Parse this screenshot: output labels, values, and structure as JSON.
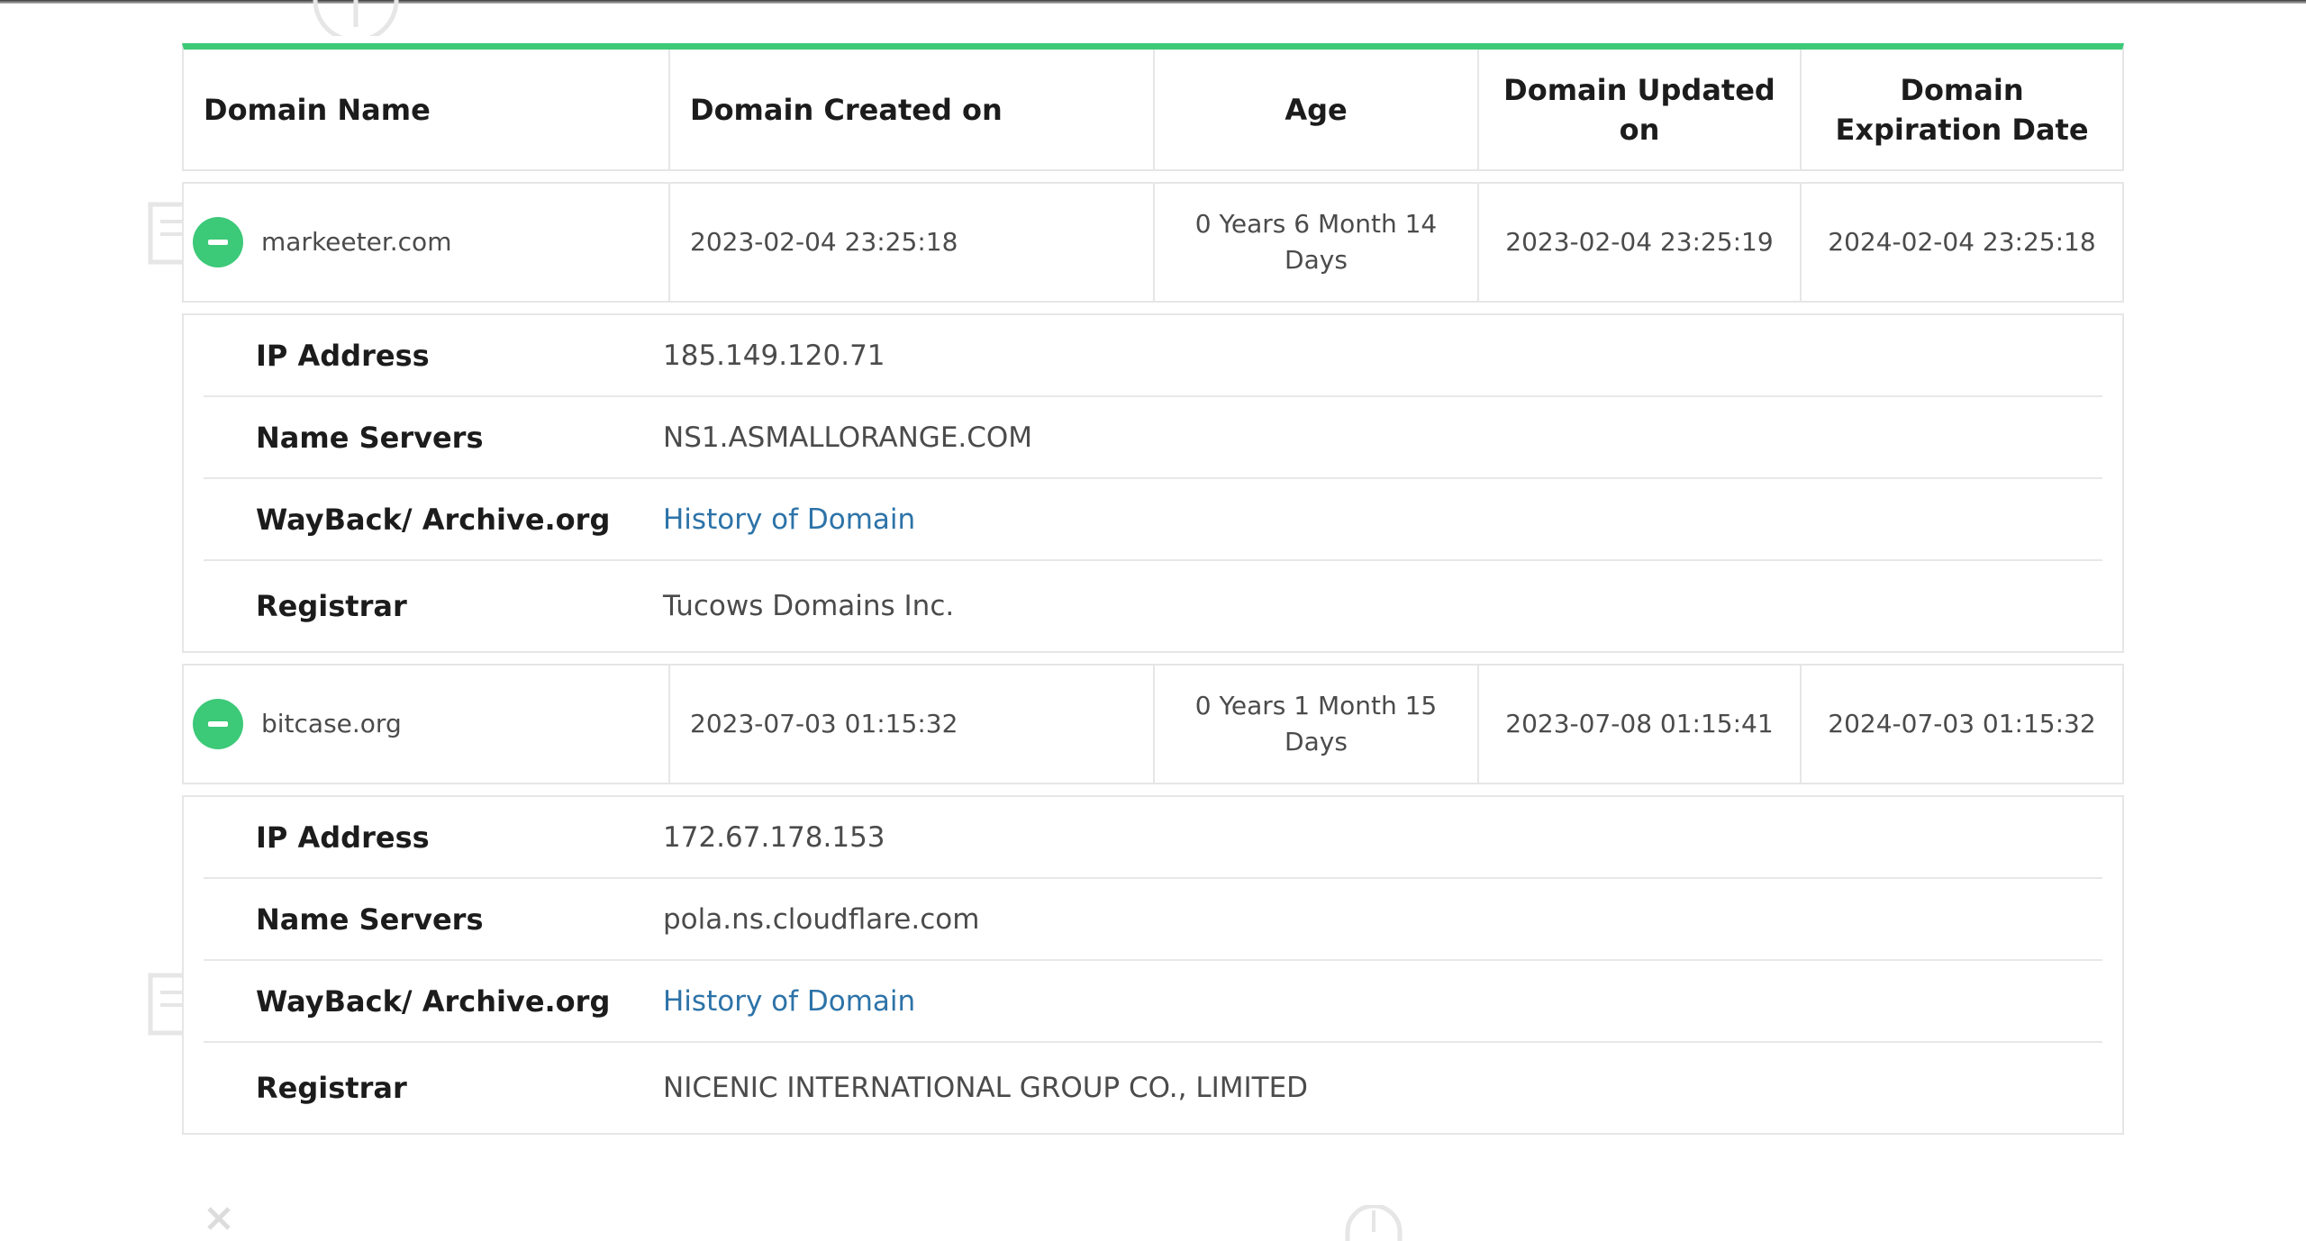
{
  "columns": [
    "Domain Name",
    "Domain Created on",
    "Age",
    "Domain Updated on",
    "Domain Expiration Date"
  ],
  "detail_labels": {
    "ip": "IP Address",
    "ns": "Name Servers",
    "wayback": "WayBack/ Archive.org",
    "registrar": "Registrar"
  },
  "domains": [
    {
      "name": "markeeter.com",
      "created": "2023-02-04 23:25:18",
      "age": "0 Years 6 Month 14 Days",
      "updated": "2023-02-04 23:25:19",
      "expires": "2024-02-04 23:25:18",
      "ip": "185.149.120.71",
      "ns": "NS1.ASMALLORANGE.COM",
      "wayback": "History of Domain",
      "registrar": "Tucows Domains Inc."
    },
    {
      "name": "bitcase.org",
      "created": "2023-07-03 01:15:32",
      "age": "0 Years 1 Month 15 Days",
      "updated": "2023-07-08 01:15:41",
      "expires": "2024-07-03 01:15:32",
      "ip": "172.67.178.153",
      "ns": "pola.ns.cloudflare.com",
      "wayback": "History of Domain",
      "registrar": "NICENIC INTERNATIONAL GROUP CO., LIMITED"
    }
  ],
  "colors": {
    "accent": "#3cc978",
    "link": "#2d73a8",
    "border": "#e6e6e6"
  },
  "icons": {
    "toggle": "collapse-minus-icon"
  }
}
